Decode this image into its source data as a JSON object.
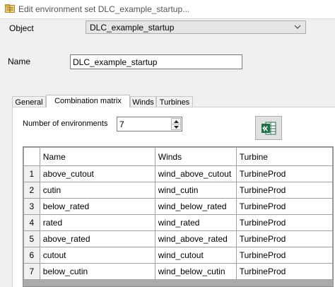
{
  "window": {
    "title": "Edit environment set DLC_example_startup...",
    "icon": "folder-grid-icon"
  },
  "object": {
    "label": "Object",
    "value": "DLC_example_startup"
  },
  "name": {
    "label": "Name",
    "value": "DLC_example_startup"
  },
  "tabs": [
    {
      "label": "General",
      "active": false
    },
    {
      "label": "Combination matrix",
      "active": true
    },
    {
      "label": "Winds",
      "active": false
    },
    {
      "label": "Turbines",
      "active": false
    }
  ],
  "environments": {
    "label": "Number of environments",
    "value": "7"
  },
  "export_button": {
    "icon": "excel-export-icon",
    "color": "#1d7044"
  },
  "table": {
    "columns": [
      "Name",
      "Winds",
      "Turbine"
    ],
    "rows": [
      {
        "num": "1",
        "name": "above_cutout",
        "wind": "wind_above_cutout",
        "turbine": "TurbineProd"
      },
      {
        "num": "2",
        "name": "cutin",
        "wind": "wind_cutin",
        "turbine": "TurbineProd"
      },
      {
        "num": "3",
        "name": "below_rated",
        "wind": "wind_below_rated",
        "turbine": "TurbineProd"
      },
      {
        "num": "4",
        "name": "rated",
        "wind": "wind_rated",
        "turbine": "TurbineProd"
      },
      {
        "num": "5",
        "name": "above_rated",
        "wind": "wind_above_rated",
        "turbine": "TurbineProd"
      },
      {
        "num": "6",
        "name": "cutout",
        "wind": "wind_cutout",
        "turbine": "TurbineProd"
      },
      {
        "num": "7",
        "name": "below_cutin",
        "wind": "wind_below_cutin",
        "turbine": "TurbineProd"
      }
    ]
  }
}
